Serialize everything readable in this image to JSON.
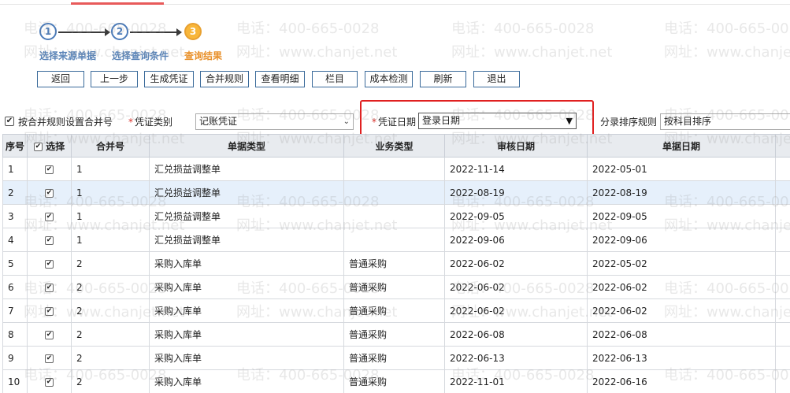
{
  "steps": [
    {
      "number": "1",
      "label": "选择来源单据",
      "active": false
    },
    {
      "number": "2",
      "label": "选择查询条件",
      "active": false
    },
    {
      "number": "3",
      "label": "查询结果",
      "active": true
    }
  ],
  "toolbar": {
    "back": "返回",
    "prev": "上一步",
    "gen_voucher": "生成凭证",
    "merge_rule": "合并规则",
    "view_detail": "查看明细",
    "columns": "栏目",
    "cost_check": "成本检测",
    "refresh": "刷新",
    "exit": "退出"
  },
  "filters": {
    "merge_checkbox_label": "按合并规则设置合并号",
    "merge_checked": true,
    "voucher_type_label": "凭证类别",
    "voucher_type_value": "记账凭证",
    "voucher_date_label": "凭证日期",
    "voucher_date_value": "登录日期",
    "sort_rule_label": "分录排序规则",
    "sort_rule_value": "按科目排序",
    "required_mark": "*"
  },
  "table": {
    "headers": {
      "seq": "序号",
      "select": "选择",
      "merge_no": "合并号",
      "doc_type": "单据类型",
      "biz_type": "业务类型",
      "audit_date": "审核日期",
      "doc_date": "单据日期"
    },
    "rows": [
      {
        "seq": "1",
        "merge_no": "1",
        "doc_type": "汇兑损益调整单",
        "biz_type": "",
        "audit_date": "2022-11-14",
        "doc_date": "2022-05-01"
      },
      {
        "seq": "2",
        "merge_no": "1",
        "doc_type": "汇兑损益调整单",
        "biz_type": "",
        "audit_date": "2022-08-19",
        "doc_date": "2022-08-19"
      },
      {
        "seq": "3",
        "merge_no": "1",
        "doc_type": "汇兑损益调整单",
        "biz_type": "",
        "audit_date": "2022-09-05",
        "doc_date": "2022-09-05"
      },
      {
        "seq": "4",
        "merge_no": "1",
        "doc_type": "汇兑损益调整单",
        "biz_type": "",
        "audit_date": "2022-09-06",
        "doc_date": "2022-09-06"
      },
      {
        "seq": "5",
        "merge_no": "2",
        "doc_type": "采购入库单",
        "biz_type": "普通采购",
        "audit_date": "2022-06-02",
        "doc_date": "2022-05-02"
      },
      {
        "seq": "6",
        "merge_no": "2",
        "doc_type": "采购入库单",
        "biz_type": "普通采购",
        "audit_date": "2022-06-02",
        "doc_date": "2022-06-02"
      },
      {
        "seq": "7",
        "merge_no": "2",
        "doc_type": "采购入库单",
        "biz_type": "普通采购",
        "audit_date": "2022-06-02",
        "doc_date": "2022-06-02"
      },
      {
        "seq": "8",
        "merge_no": "2",
        "doc_type": "采购入库单",
        "biz_type": "普通采购",
        "audit_date": "2022-06-08",
        "doc_date": "2022-06-08"
      },
      {
        "seq": "9",
        "merge_no": "2",
        "doc_type": "采购入库单",
        "biz_type": "普通采购",
        "audit_date": "2022-06-13",
        "doc_date": "2022-06-13"
      },
      {
        "seq": "10",
        "merge_no": "2",
        "doc_type": "采购入库单",
        "biz_type": "普通采购",
        "audit_date": "2022-11-01",
        "doc_date": "2022-06-16"
      }
    ]
  },
  "watermark": {
    "phone": "电话：400-665-0028",
    "site": "网址：www.chanjet.net"
  }
}
